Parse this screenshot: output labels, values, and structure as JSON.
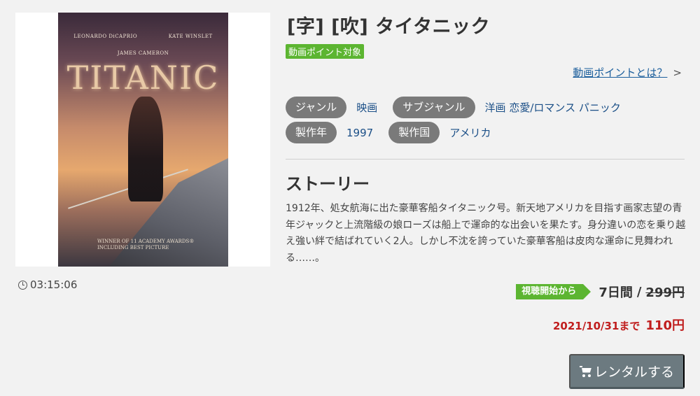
{
  "poster": {
    "actor1": "LEONARDO DiCAPRIO",
    "actor2": "KATE WINSLET",
    "director": "JAMES CAMERON",
    "logo_text": "TITANIC",
    "awards_line1": "WINNER OF 11 ACADEMY AWARDS®",
    "awards_line2": "INCLUDING BEST PICTURE"
  },
  "duration": "03:15:06",
  "title": "[字] [吹] タイタニック",
  "point_badge": "動画ポイント対象",
  "point_link": {
    "label": "動画ポイントとは？",
    "chevron": ">"
  },
  "meta": {
    "genre_label": "ジャンル",
    "genre_value": "映画",
    "subgenre_label": "サブジャンル",
    "subgenre_value": "洋画 恋愛/ロマンス パニック",
    "year_label": "製作年",
    "year_value": "1997",
    "country_label": "製作国",
    "country_value": "アメリカ"
  },
  "story": {
    "heading": "ストーリー",
    "text": "1912年、処女航海に出た豪華客船タイタニック号。新天地アメリカを目指す画家志望の青年ジャックと上流階級の娘ローズは船上で運命的な出会いを果たす。身分違いの恋を乗り越え強い絆で結ばれていく2人。しかし不沈を誇っていた豪華客船は皮肉な運命に見舞われる……。"
  },
  "pricing": {
    "badge": "視聴開始から",
    "period": "7日間",
    "slash": "/",
    "original_price": "299円",
    "sale_until": "2021/10/31まで",
    "sale_price": "110円"
  },
  "rent_button": {
    "label": "レンタルする"
  },
  "colors": {
    "accent_green": "#5cb531",
    "sale_red": "#c01d1d",
    "button_gray": "#6c7a80",
    "link_blue": "#1b5e9c"
  }
}
